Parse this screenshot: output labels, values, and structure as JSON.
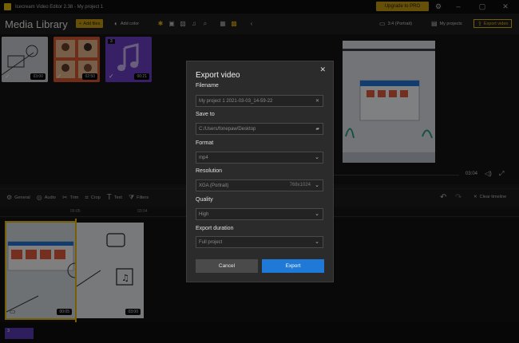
{
  "titlebar": {
    "title": "Icecream Video Editor 2.38 - My project 1",
    "upgrade_label": "Upgrade to PRO"
  },
  "library": {
    "title": "Media Library",
    "add_files_label": "Add files",
    "add_color_label": "Add color",
    "thumbs": [
      {
        "duration": "03:00",
        "badge": ""
      },
      {
        "duration": "02:50",
        "badge": ""
      },
      {
        "duration": "00:21",
        "badge": "3"
      }
    ]
  },
  "preview": {
    "aspect_label": "3:4 (Portrait)",
    "my_projects_label": "My projects",
    "export_label": "Export video",
    "current_time": "03:04"
  },
  "toolbar": {
    "general": "General",
    "audio": "Audio",
    "trim": "Trim",
    "crop": "Crop",
    "text": "Text",
    "filters": "Filters",
    "clear_timeline": "Clear timeline"
  },
  "timeline": {
    "ruler_marks": [
      "00:05",
      "03:04"
    ],
    "clips": [
      {
        "duration": "00:05"
      },
      {
        "duration": "03:00"
      }
    ],
    "audio_clip_label": "3"
  },
  "dialog": {
    "title": "Export video",
    "filename_label": "Filename",
    "filename_value": "My project 1 2021-03-03_14-59-22",
    "saveto_label": "Save to",
    "saveto_value": "C:/Users/fonepaw/Desktop",
    "format_label": "Format",
    "format_value": "mp4",
    "resolution_label": "Resolution",
    "resolution_value": "XGA (Portrait)",
    "resolution_size": "768x1024",
    "quality_label": "Quality",
    "quality_value": "High",
    "duration_label": "Export duration",
    "duration_value": "Full project",
    "cancel_label": "Cancel",
    "export_label": "Export"
  },
  "colors": {
    "accent": "#e2b70a",
    "primary_button": "#1e7ad6",
    "audio_clip": "#5b3bb5"
  }
}
